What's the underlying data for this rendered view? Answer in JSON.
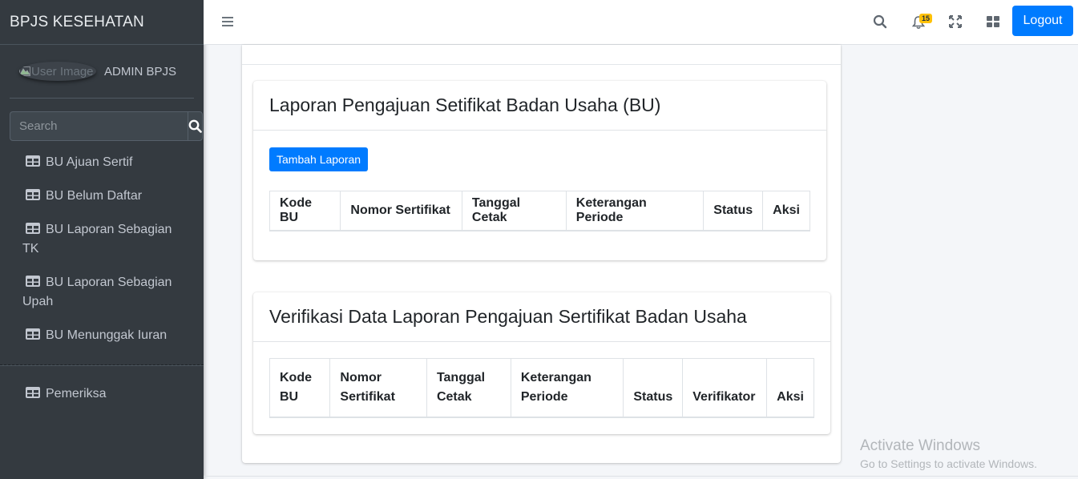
{
  "brand": {
    "title": "BPJS KESEHATAN"
  },
  "user": {
    "image_alt": "User Image",
    "name": "ADMIN BPJS"
  },
  "sidebar_search": {
    "placeholder": "Search"
  },
  "sidebar": {
    "items": [
      {
        "label": "BU Ajuan Sertif",
        "icon": "table-icon"
      },
      {
        "label": "BU Belum Daftar",
        "icon": "table-icon"
      },
      {
        "label_line1": "BU Laporan Sebagian",
        "label_line2": "TK",
        "icon": "table-icon"
      },
      {
        "label_line1": "BU Laporan Sebagian",
        "label_line2": "Upah",
        "icon": "table-icon"
      },
      {
        "label": "BU Menunggak Iuran",
        "icon": "table-icon"
      }
    ],
    "secondary": {
      "label": "Pemeriksa",
      "icon": "table-icon"
    }
  },
  "navbar": {
    "notification_count": "15",
    "logout_label": "Logout",
    "icons": [
      "menu-icon",
      "search-icon",
      "bell-icon",
      "expand-icon",
      "grid-icon"
    ]
  },
  "card1": {
    "title": "Laporan Pengajuan Setifikat Badan Usaha (BU)",
    "add_button": "Tambah Laporan",
    "columns": [
      "Kode BU",
      "Nomor Sertifikat",
      "Tanggal Cetak",
      "Keterangan Periode",
      "Status",
      "Aksi"
    ]
  },
  "card2": {
    "title": "Verifikasi Data Laporan Pengajuan Sertifikat Badan Usaha",
    "columns": [
      {
        "line1": "Kode",
        "line2": "BU"
      },
      {
        "line1": "Nomor",
        "line2": "Sertifikat"
      },
      {
        "line1": "Tanggal",
        "line2": "Cetak"
      },
      {
        "line1": "Keterangan",
        "line2": "Periode"
      },
      {
        "line1": "",
        "line2": "Status"
      },
      {
        "line1": "",
        "line2": "Verifikator"
      },
      {
        "line1": "",
        "line2": "Aksi"
      }
    ]
  },
  "watermark": {
    "title": "Activate Windows",
    "subtitle": "Go to Settings to activate Windows."
  },
  "colors": {
    "sidebar_bg": "#343a40",
    "primary": "#007bff",
    "badge": "#ffc107",
    "page_bg": "#f4f6f9"
  }
}
